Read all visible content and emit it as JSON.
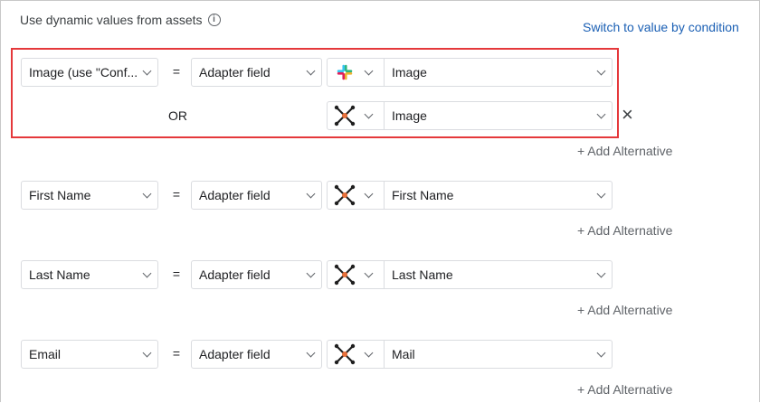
{
  "header": {
    "label": "Use dynamic values from assets",
    "switch_label": "Switch to value by condition"
  },
  "icons": {
    "info": "info-icon",
    "slack": "slack-logo-icon",
    "adapter": "network-cross-icon",
    "close": "close-icon"
  },
  "colors": {
    "link": "#1a5fb4",
    "highlight": "#e5383b",
    "adapter_dot": "#e8703a"
  },
  "rows": [
    {
      "source": "Image (use \"Conf...",
      "equals": "=",
      "mapping": "Adapter field",
      "adapter_field": "Image",
      "alternative": {
        "or_label": "OR",
        "adapter_field": "Image"
      },
      "add_alternative": "+ Add Alternative"
    },
    {
      "source": "First Name",
      "equals": "=",
      "mapping": "Adapter field",
      "adapter_field": "First Name",
      "add_alternative": "+ Add Alternative"
    },
    {
      "source": "Last Name",
      "equals": "=",
      "mapping": "Adapter field",
      "adapter_field": "Last Name",
      "add_alternative": "+ Add Alternative"
    },
    {
      "source": "Email",
      "equals": "=",
      "mapping": "Adapter field",
      "adapter_field": "Mail",
      "add_alternative": "+ Add Alternative"
    }
  ]
}
